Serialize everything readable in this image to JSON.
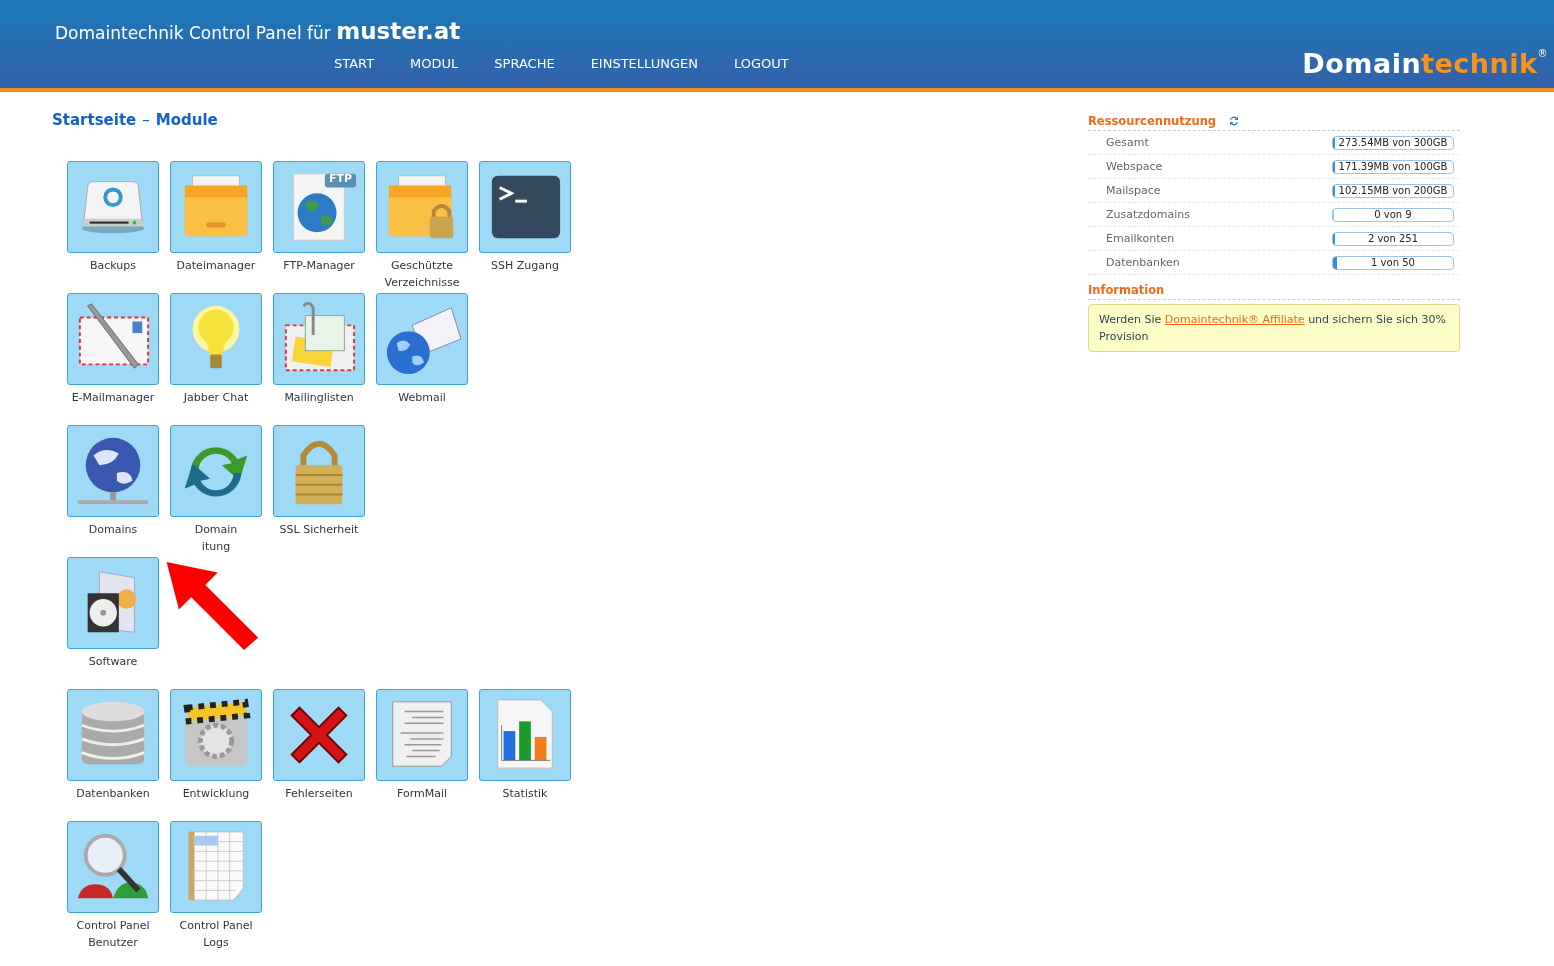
{
  "header": {
    "title": "Domaintechnik Control Panel für",
    "domain": "muster.at",
    "logo": {
      "first": "Domain",
      "second": "technik",
      "mark": "®"
    }
  },
  "nav": [
    {
      "label": "START"
    },
    {
      "label": "MODUL"
    },
    {
      "label": "SPRACHE"
    },
    {
      "label": "EINSTELLUNGEN"
    },
    {
      "label": "LOGOUT"
    }
  ],
  "breadcrumb": {
    "items": [
      "Startseite",
      "Module"
    ],
    "separator": "–"
  },
  "module_rows": [
    [
      {
        "lines": [
          "Backups"
        ]
      },
      {
        "lines": [
          "Dateimanager"
        ]
      },
      {
        "lines": [
          "FTP-Manager"
        ],
        "badge": "FTP"
      },
      {
        "lines": [
          "Geschützte",
          "Verzeichnisse"
        ]
      },
      {
        "lines": [
          "SSH Zugang"
        ]
      }
    ],
    [
      {
        "lines": [
          "E-Mailmanager"
        ]
      },
      {
        "lines": [
          "Jabber Chat"
        ]
      },
      {
        "lines": [
          "Mailinglisten"
        ]
      },
      {
        "lines": [
          "Webmail"
        ]
      }
    ],
    [
      {
        "lines": [
          "Domains"
        ]
      },
      {
        "lines": [
          "Domain",
          "itung"
        ]
      },
      {
        "lines": [
          "SSL Sicherheit"
        ]
      }
    ],
    [
      {
        "lines": [
          "Software"
        ]
      }
    ],
    [
      {
        "lines": [
          "Datenbanken"
        ]
      },
      {
        "lines": [
          "Entwicklung"
        ]
      },
      {
        "lines": [
          "Fehlerseiten"
        ]
      },
      {
        "lines": [
          "FormMail"
        ]
      },
      {
        "lines": [
          "Statistik"
        ]
      }
    ],
    [
      {
        "lines": [
          "Control Panel",
          "Benutzer"
        ]
      },
      {
        "lines": [
          "Control Panel",
          "Logs"
        ]
      }
    ]
  ],
  "resources": {
    "title": "Ressourcennutzung",
    "items": [
      {
        "label": "Gesamt",
        "reading": "273.54MB von 300GB",
        "level": 0.01
      },
      {
        "label": "Webspace",
        "reading": "171.39MB von 100GB",
        "level": 0.01
      },
      {
        "label": "Mailspace",
        "reading": "102.15MB von 200GB",
        "level": 0.01
      },
      {
        "label": "Zusatzdomains",
        "reading": "0 von 9",
        "level": 0
      },
      {
        "label": "Emailkonten",
        "reading": "2 von 251",
        "level": 0.01
      },
      {
        "label": "Datenbanken",
        "reading": "1 von 50",
        "level": 0.03
      }
    ]
  },
  "information": {
    "title": "Information",
    "before": "Werden Sie",
    "link": "Domaintechnik® Affiliate",
    "after": "und sichern Sie sich 30% Provision"
  }
}
